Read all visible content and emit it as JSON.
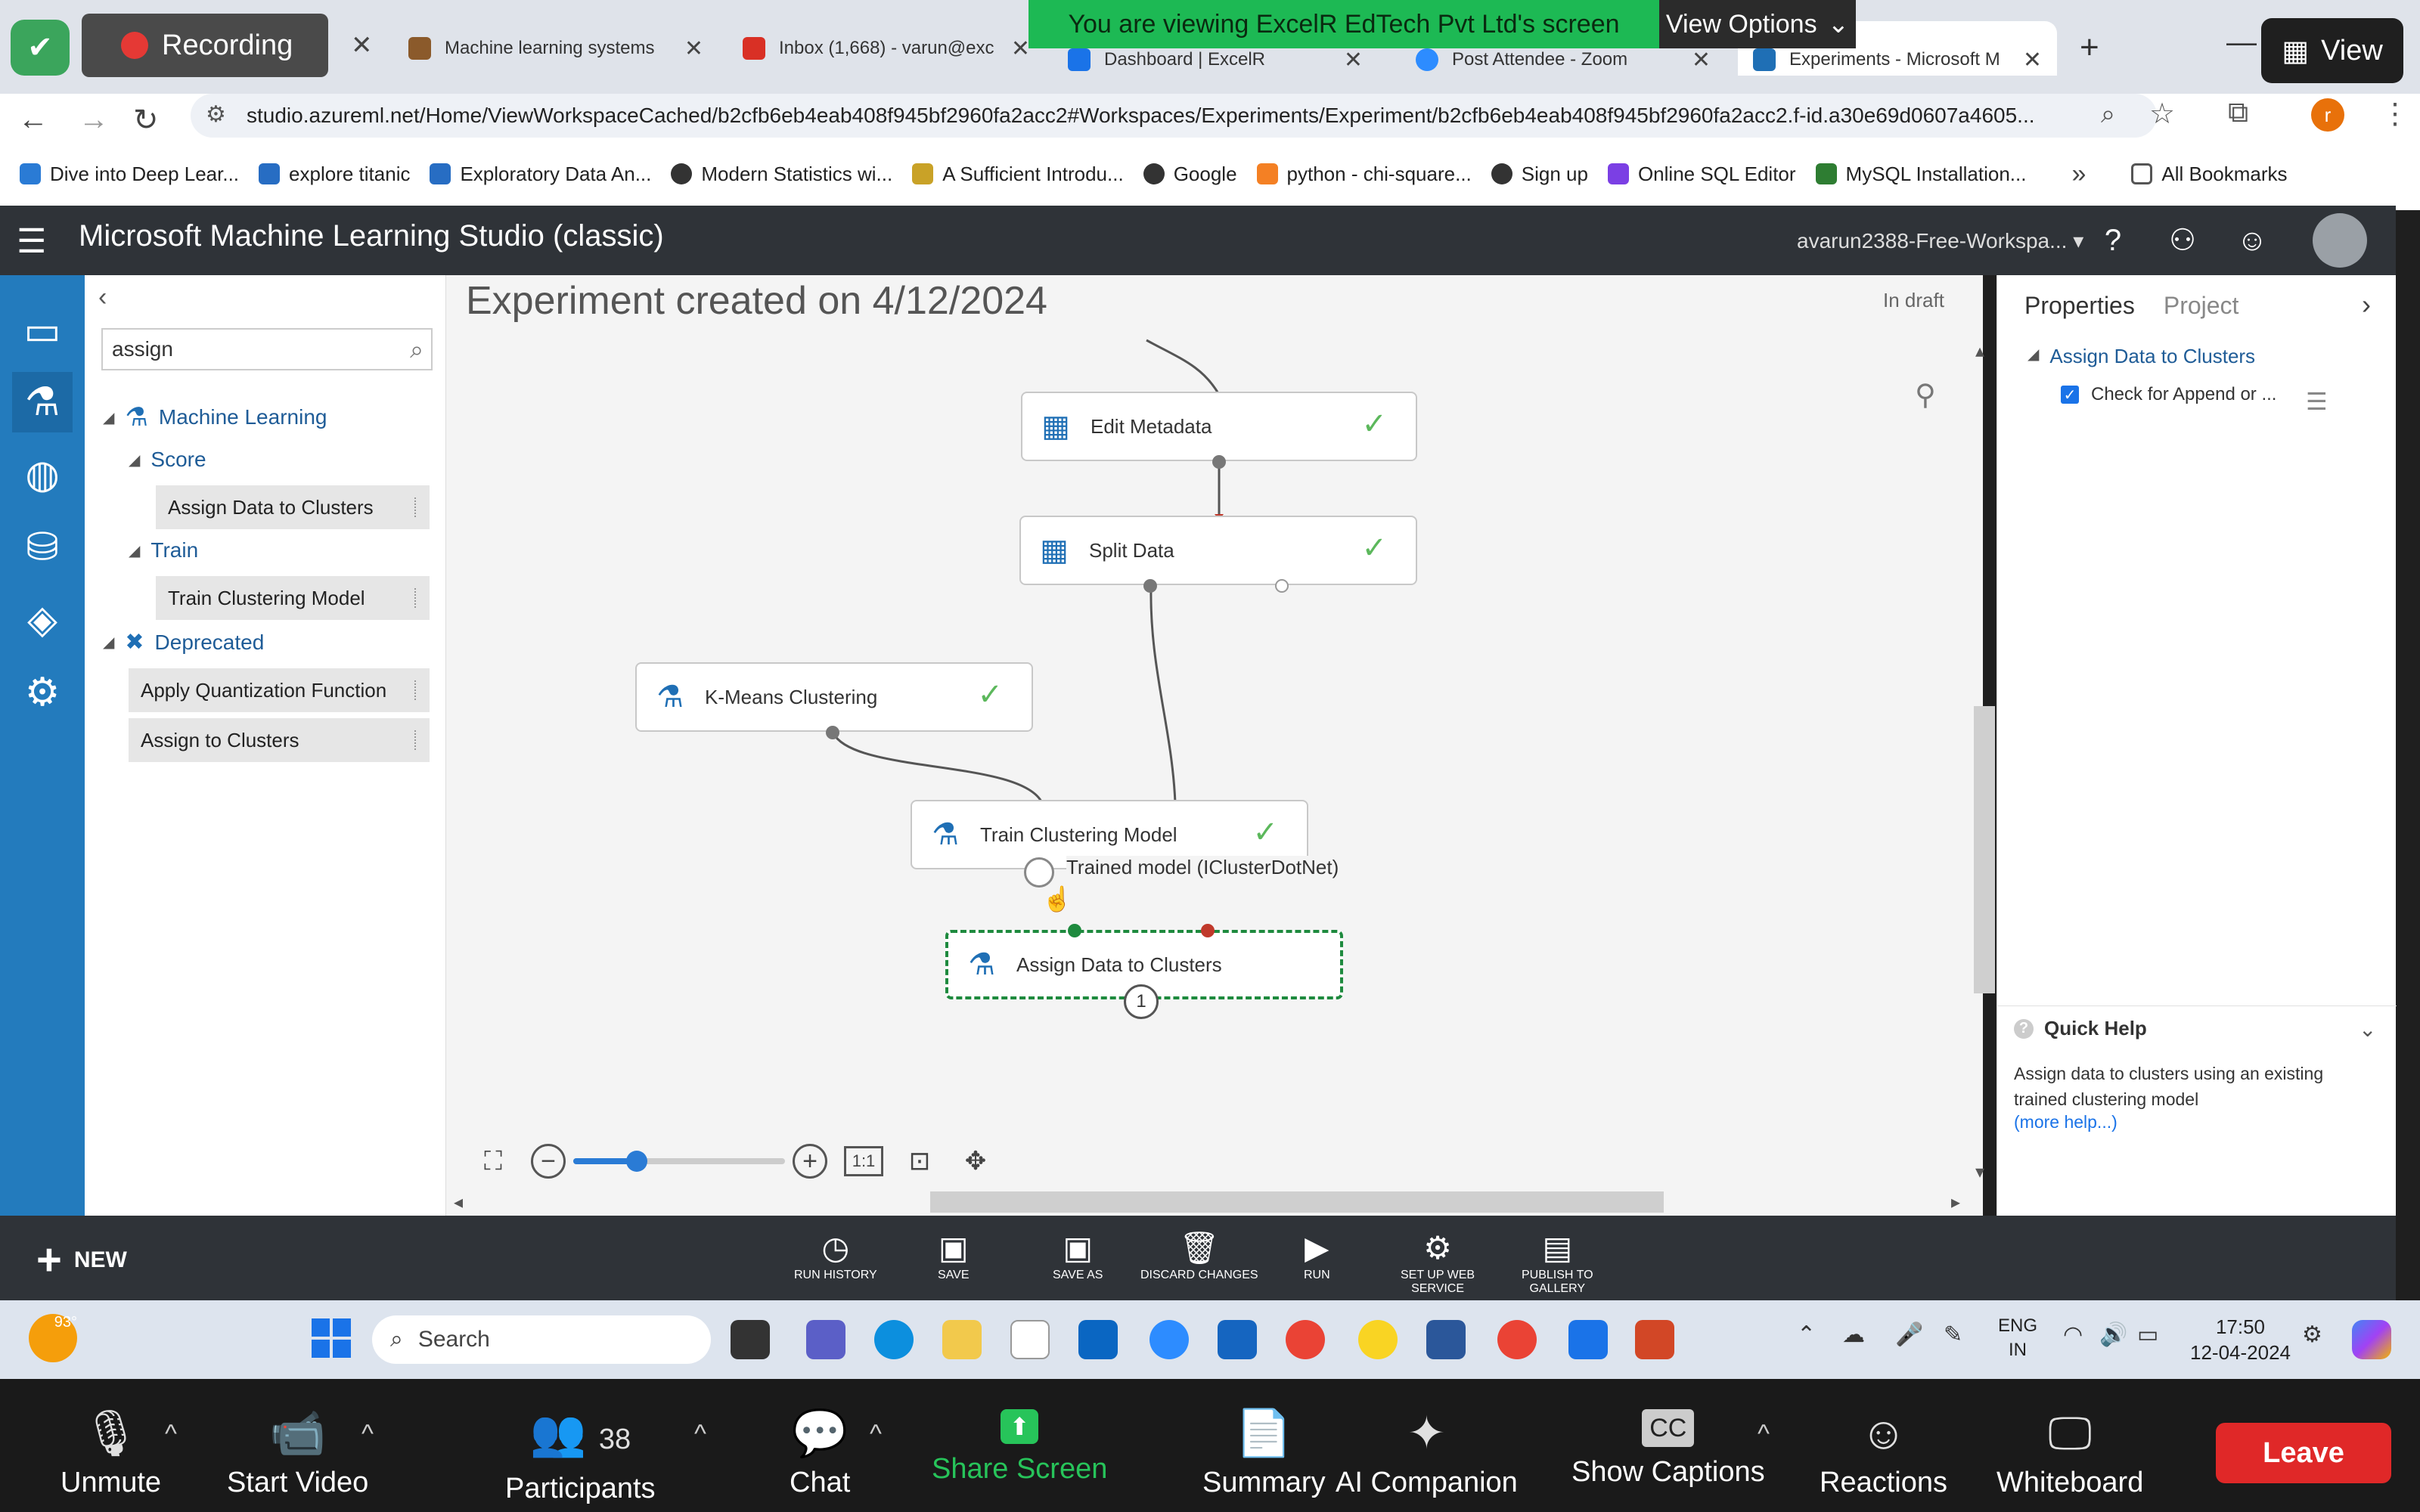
{
  "zoom_overlay": {
    "recording_label": "Recording",
    "viewing_banner": "You are viewing ExcelR EdTech Pvt Ltd's screen",
    "view_options": "View Options",
    "view_button": "View"
  },
  "browser": {
    "tabs": [
      {
        "label": "Machine learning systems",
        "color": "#8b5a2b"
      },
      {
        "label": "Inbox (1,668) - varun@exc",
        "color": "#d93025"
      },
      {
        "label": "Dashboard | ExcelR",
        "color": "#1a73e8"
      },
      {
        "label": "Post Attendee - Zoom",
        "color": "#2d8cff"
      },
      {
        "label": "Experiments - Microsoft M",
        "color": "#1f6fb5"
      }
    ],
    "url": "studio.azureml.net/Home/ViewWorkspaceCached/b2cfb6eb4eab408f945bf2960fa2acc2#Workspaces/Experiments/Experiment/b2cfb6eb4eab408f945bf2960fa2acc2.f-id.a30e69d0607a4605...",
    "profile_initial": "r",
    "bookmarks": [
      "Dive into Deep Lear...",
      "explore titanic",
      "Exploratory Data An...",
      "Modern Statistics wi...",
      "A Sufficient Introdu...",
      "Google",
      "python - chi-square...",
      "Sign up",
      "Online SQL Editor",
      "MySQL Installation..."
    ],
    "all_bookmarks": "All Bookmarks"
  },
  "studio": {
    "title": "Microsoft Machine Learning Studio (classic)",
    "workspace": "avarun2388-Free-Workspa...",
    "experiment_title": "Experiment created on 4/12/2024",
    "status": "In draft"
  },
  "palette": {
    "search_value": "assign",
    "tree": {
      "machine_learning": "Machine Learning",
      "score": "Score",
      "score_item": "Assign Data to Clusters",
      "train": "Train",
      "train_item": "Train Clustering Model",
      "deprecated": "Deprecated",
      "dep_item_1": "Apply Quantization Function",
      "dep_item_2": "Assign to Clusters"
    }
  },
  "canvas": {
    "nodes": {
      "edit_metadata": "Edit Metadata",
      "split_data": "Split Data",
      "kmeans": "K-Means Clustering",
      "train_clustering": "Train Clustering Model",
      "assign_clusters": "Assign Data to Clusters"
    },
    "tooltip": "Trained model (IClusterDotNet)",
    "badge": "1",
    "zoom_level": 0.3,
    "zoom_1to1": "1:1"
  },
  "properties": {
    "tab_properties": "Properties",
    "tab_project": "Project",
    "section": "Assign Data to Clusters",
    "checkbox_label": "Check for Append or ...",
    "checkbox_checked": true,
    "quick_help_title": "Quick Help",
    "quick_help_text": "Assign data to clusters using an existing trained clustering model",
    "more_help": "(more help...)"
  },
  "commands": {
    "new": "NEW",
    "run_history": "RUN HISTORY",
    "save": "SAVE",
    "save_as": "SAVE AS",
    "discard": "DISCARD CHANGES",
    "run": "RUN",
    "web_service": "SET UP WEB\nSERVICE",
    "publish": "PUBLISH TO\nGALLERY"
  },
  "taskbar": {
    "weather": "93°",
    "search": "Search",
    "lang_1": "ENG",
    "lang_2": "IN",
    "time": "17:50",
    "date": "12-04-2024"
  },
  "meeting": {
    "unmute": "Unmute",
    "start_video": "Start Video",
    "participants_count": "38",
    "participants": "Participants",
    "chat": "Chat",
    "share_screen": "Share Screen",
    "summary": "Summary",
    "ai_companion": "AI Companion",
    "captions": "Show Captions",
    "reactions": "Reactions",
    "whiteboard": "Whiteboard",
    "leave": "Leave"
  }
}
